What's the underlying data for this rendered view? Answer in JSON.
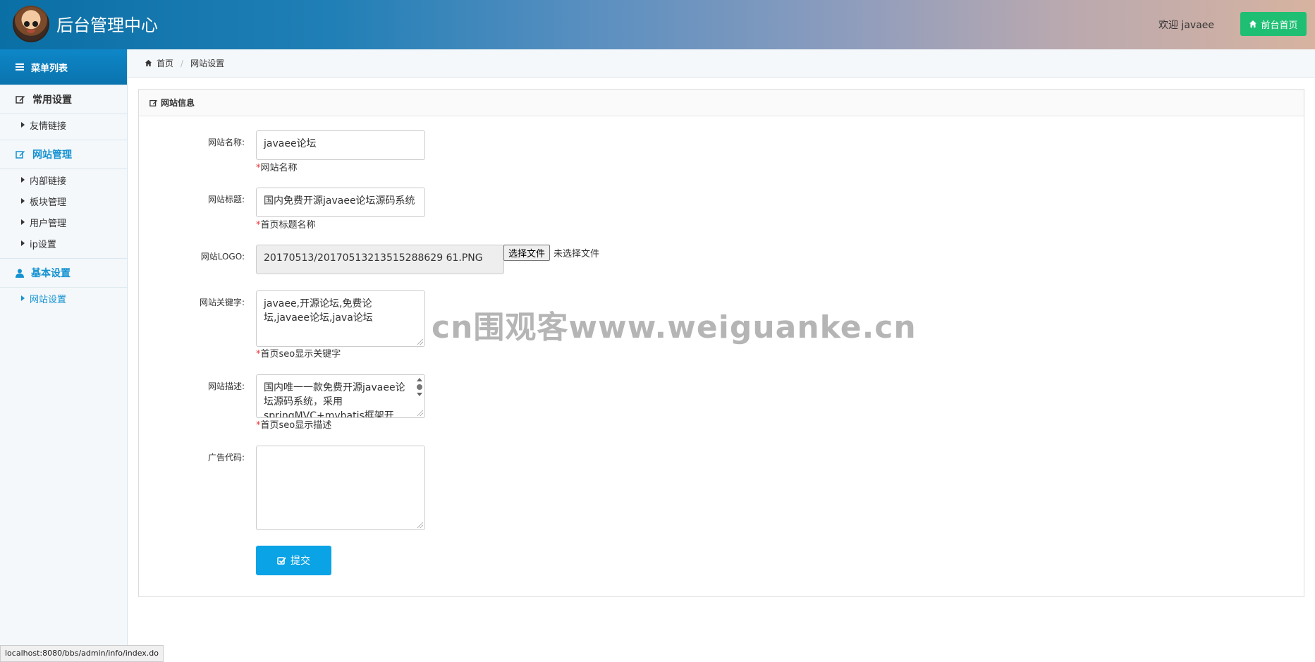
{
  "header": {
    "title": "后台管理中心",
    "welcome": "欢迎 javaee",
    "home_button": "前台首页"
  },
  "sidebar": {
    "menu_title": "菜单列表",
    "groups": [
      {
        "label": "常用设置",
        "icon": "edit-icon",
        "items": [
          "友情链接"
        ]
      },
      {
        "label": "网站管理",
        "icon": "edit-icon",
        "items": [
          "内部链接",
          "板块管理",
          "用户管理",
          "ip设置"
        ]
      },
      {
        "label": "基本设置",
        "icon": "user-icon",
        "items": [
          "网站设置"
        ]
      }
    ],
    "active_item": "网站设置"
  },
  "breadcrumb": {
    "home": "首页",
    "current": "网站设置"
  },
  "panel": {
    "title": "网站信息",
    "fields": {
      "site_name": {
        "label": "网站名称:",
        "value": "javaee论坛",
        "hint": "网站名称"
      },
      "site_title": {
        "label": "网站标题:",
        "value": "国内免费开源javaee论坛源码系统",
        "hint": "首页标题名称"
      },
      "site_logo": {
        "label": "网站LOGO:",
        "value": "20170513/20170513213515288629 61.PNG",
        "choose_button": "选择文件",
        "no_file_text": "未选择文件"
      },
      "keywords": {
        "label": "网站关键字:",
        "value": "javaee,开源论坛,免费论坛,javaee论坛,java论坛",
        "hint": "首页seo显示关键字"
      },
      "description": {
        "label": "网站描述:",
        "value": "国内唯一一款免费开源javaee论坛源码系统，采用springMVC+mybatis框架开",
        "hint": "首页seo显示描述"
      },
      "ad_code": {
        "label": "广告代码:",
        "value": ""
      }
    },
    "required_mark": "*",
    "submit_label": "提交"
  },
  "watermark": "cn围观客www.weiguanke.cn",
  "status_url": "localhost:8080/bbs/admin/info/index.do",
  "colors": {
    "accent": "#1592d1",
    "submit": "#0aa3e6",
    "home_button": "#1fbf73"
  }
}
